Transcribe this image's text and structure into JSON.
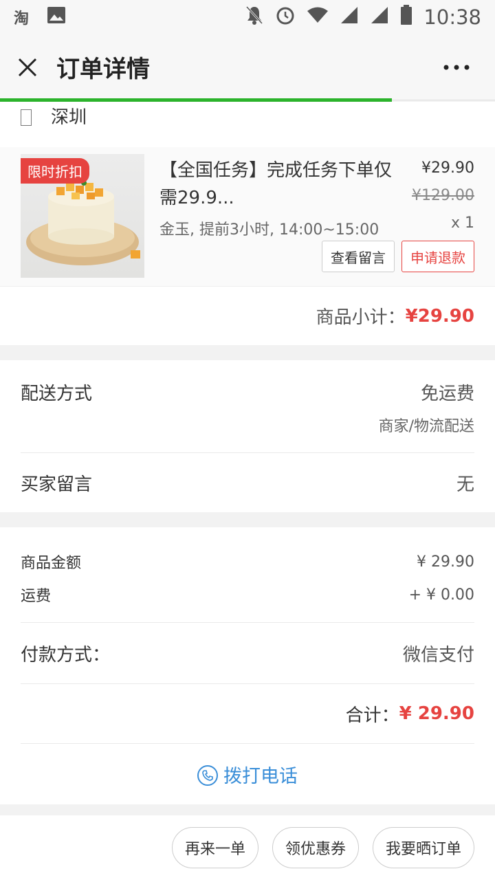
{
  "statusbar": {
    "app_label": "淘",
    "time": "10:38"
  },
  "navbar": {
    "title": "订单详情"
  },
  "address": {
    "city": "深圳"
  },
  "product": {
    "tag": "限时折扣",
    "title": "【全国任务】完成任务下单仅需29.9...",
    "price": "¥29.90",
    "original_price": "¥129.00",
    "sku": "金玉, 提前3小时, 14:00~15:00",
    "qty": "x 1",
    "view_message_btn": "查看留言",
    "refund_btn": "申请退款"
  },
  "subtotal": {
    "label": "商品小计：",
    "value": "¥29.90"
  },
  "delivery": {
    "label": "配送方式",
    "fee": "免运费",
    "method": "商家/物流配送"
  },
  "buyer_message": {
    "label": "买家留言",
    "value": "无"
  },
  "amounts": {
    "goods_label": "商品金额",
    "goods_value": "¥ 29.90",
    "freight_label": "运费",
    "freight_value": "+ ¥ 0.00"
  },
  "payment": {
    "label": "付款方式：",
    "value": "微信支付"
  },
  "total": {
    "label": "合计：",
    "value": "¥ 29.90"
  },
  "call": {
    "label": "拨打电话"
  },
  "bottom": {
    "reorder": "再来一单",
    "coupon": "领优惠券",
    "share": "我要晒订单"
  },
  "colors": {
    "accent_red": "#e64340",
    "link_blue": "#3a8ed8",
    "progress_green": "#2bb32b"
  }
}
